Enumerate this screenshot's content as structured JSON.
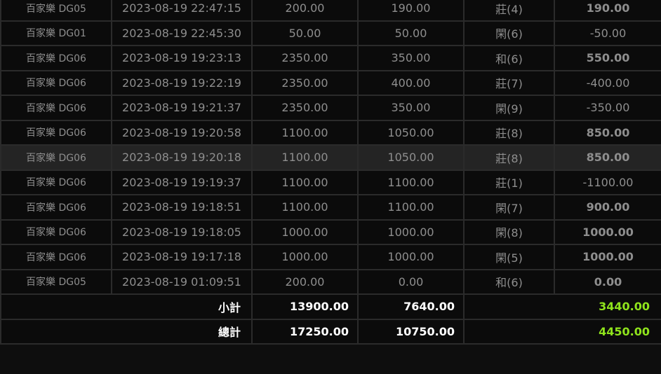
{
  "colors": {
    "banker": "#e21b1b",
    "player": "#1e8fe6",
    "tie": "#8fe31c",
    "profit": "#8fe31c",
    "loss": "#f01818"
  },
  "rows": [
    {
      "game": "百家樂 DG05",
      "time": "2023-08-19 22:47:15",
      "bet": "200.00",
      "valid": "190.00",
      "result": "莊(4)",
      "result_type": "banker",
      "pl": "190.00",
      "pl_sign": "pos"
    },
    {
      "game": "百家樂 DG01",
      "time": "2023-08-19 22:45:30",
      "bet": "50.00",
      "valid": "50.00",
      "result": "閑(6)",
      "result_type": "player",
      "pl": "-50.00",
      "pl_sign": "neg"
    },
    {
      "game": "百家樂 DG06",
      "time": "2023-08-19 19:23:13",
      "bet": "2350.00",
      "valid": "350.00",
      "result": "和(6)",
      "result_type": "tie",
      "pl": "550.00",
      "pl_sign": "pos"
    },
    {
      "game": "百家樂 DG06",
      "time": "2023-08-19 19:22:19",
      "bet": "2350.00",
      "valid": "400.00",
      "result": "莊(7)",
      "result_type": "banker",
      "pl": "-400.00",
      "pl_sign": "neg"
    },
    {
      "game": "百家樂 DG06",
      "time": "2023-08-19 19:21:37",
      "bet": "2350.00",
      "valid": "350.00",
      "result": "閑(9)",
      "result_type": "player",
      "pl": "-350.00",
      "pl_sign": "neg"
    },
    {
      "game": "百家樂 DG06",
      "time": "2023-08-19 19:20:58",
      "bet": "1100.00",
      "valid": "1050.00",
      "result": "莊(8)",
      "result_type": "banker",
      "pl": "850.00",
      "pl_sign": "pos"
    },
    {
      "game": "百家樂 DG06",
      "time": "2023-08-19 19:20:18",
      "bet": "1100.00",
      "valid": "1050.00",
      "result": "莊(8)",
      "result_type": "banker",
      "pl": "850.00",
      "pl_sign": "pos",
      "highlight": true
    },
    {
      "game": "百家樂 DG06",
      "time": "2023-08-19 19:19:37",
      "bet": "1100.00",
      "valid": "1100.00",
      "result": "莊(1)",
      "result_type": "banker",
      "pl": "-1100.00",
      "pl_sign": "neg"
    },
    {
      "game": "百家樂 DG06",
      "time": "2023-08-19 19:18:51",
      "bet": "1100.00",
      "valid": "1100.00",
      "result": "閑(7)",
      "result_type": "player",
      "pl": "900.00",
      "pl_sign": "pos"
    },
    {
      "game": "百家樂 DG06",
      "time": "2023-08-19 19:18:05",
      "bet": "1000.00",
      "valid": "1000.00",
      "result": "閑(8)",
      "result_type": "player",
      "pl": "1000.00",
      "pl_sign": "pos"
    },
    {
      "game": "百家樂 DG06",
      "time": "2023-08-19 19:17:18",
      "bet": "1000.00",
      "valid": "1000.00",
      "result": "閑(5)",
      "result_type": "player",
      "pl": "1000.00",
      "pl_sign": "pos"
    },
    {
      "game": "百家樂 DG05",
      "time": "2023-08-19 01:09:51",
      "bet": "200.00",
      "valid": "0.00",
      "result": "和(6)",
      "result_type": "tie",
      "pl": "0.00",
      "pl_sign": "pos"
    }
  ],
  "subtotal": {
    "label": "小計",
    "bet": "13900.00",
    "valid": "7640.00",
    "pl": "3440.00"
  },
  "total": {
    "label": "總計",
    "bet": "17250.00",
    "valid": "10750.00",
    "pl": "4450.00"
  }
}
